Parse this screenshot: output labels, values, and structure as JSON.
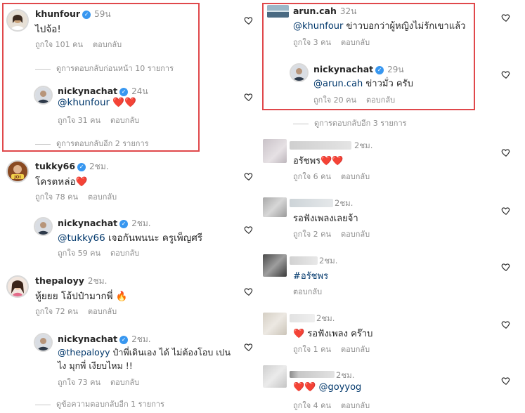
{
  "left": {
    "c1": {
      "user": "khunfour",
      "time": "59น",
      "text": "ไปจ้อ!",
      "likes": "ถูกใจ 101 คน",
      "reply": "ตอบกลับ"
    },
    "c1_view_prev": "ดูการตอบกลับก่อนหน้า 10 รายการ",
    "c1_r": {
      "user": "nickynachat",
      "time": "24น",
      "mention": "@khunfour",
      "emoji": "❤️❤️",
      "likes": "ถูกใจ 31 คน",
      "reply": "ตอบกลับ"
    },
    "c1_view_more": "ดูการตอบกลับอีก 2 รายการ",
    "c2": {
      "user": "tukky66",
      "time": "2ชม.",
      "text": "โครตหล่อ",
      "emoji": "❤️",
      "likes": "ถูกใจ 78 คน",
      "reply": "ตอบกลับ"
    },
    "c2_r": {
      "user": "nickynachat",
      "time": "2ชม.",
      "mention": "@tukky66",
      "text": " เจอกันพนนะ ครูเพ็ญศรี",
      "likes": "ถูกใจ 59 คน",
      "reply": "ตอบกลับ"
    },
    "c3": {
      "user": "thepaloyy",
      "time": "2ชม.",
      "text": "หู้ยยย โอ้ปป๋ามากพี่ ",
      "emoji": "🔥",
      "likes": "ถูกใจ 72 คน",
      "reply": "ตอบกลับ"
    },
    "c3_r": {
      "user": "nickynachat",
      "time": "2ชม.",
      "mention": "@thepaloyy",
      "text": "  ป๋าพี่เดินเอง ได้ ไม่ต้องโอบ เปน",
      "text2": "ไง มุกพี่ เงียบไหม !!",
      "likes": "ถูกใจ 73 คน",
      "reply": "ตอบกลับ"
    },
    "c3_view_more": "ดูข้อความตอบกลับอีก 1 รายการ"
  },
  "right": {
    "c1": {
      "user": "arun.cah",
      "time": "32น",
      "mention": "@khunfour",
      "text": " ข่าวบอกว่าผู้หญิงไม่รักเขาแล้ว",
      "likes": "ถูกใจ 3 คน",
      "reply": "ตอบกลับ"
    },
    "c1_r": {
      "user": "nickynachat",
      "time": "29น",
      "mention": "@arun.cah",
      "text": "  ข่าวมั่ว ครับ",
      "likes": "ถูกใจ 20 คน",
      "reply": "ตอบกลับ"
    },
    "c1_view_more": "ดูการตอบกลับอีก 3 รายการ",
    "c2": {
      "time": "2ชม.",
      "text": "อรัชพร",
      "emoji": "❤️❤️",
      "likes": "ถูกใจ 6 คน",
      "reply": "ตอบกลับ"
    },
    "c3": {
      "time": "2ชม.",
      "text": "รอฟังเพลงเลยจ้า",
      "likes": "ถูกใจ 2 คน",
      "reply": "ตอบกลับ"
    },
    "c4": {
      "time": "2ชม.",
      "hashtag": "#อรัชพร",
      "reply": "ตอบกลับ"
    },
    "c5": {
      "time": "2ชม.",
      "emoji": "❤️",
      "text": "  รอฟังเพลง คร๊าบ",
      "likes": "ถูกใจ 1 คน",
      "reply": "ตอบกลับ"
    },
    "c6": {
      "time": "2ชม.",
      "emoji": "❤️❤️",
      "mention": " @goyyog",
      "likes": "ถูกใจ 4 คน",
      "reply": "ตอบกลับ"
    }
  },
  "colors": {
    "highlight": "#e0484b",
    "mention": "#00376b",
    "verified": "#3897f0",
    "meta": "#8e8e8e"
  }
}
